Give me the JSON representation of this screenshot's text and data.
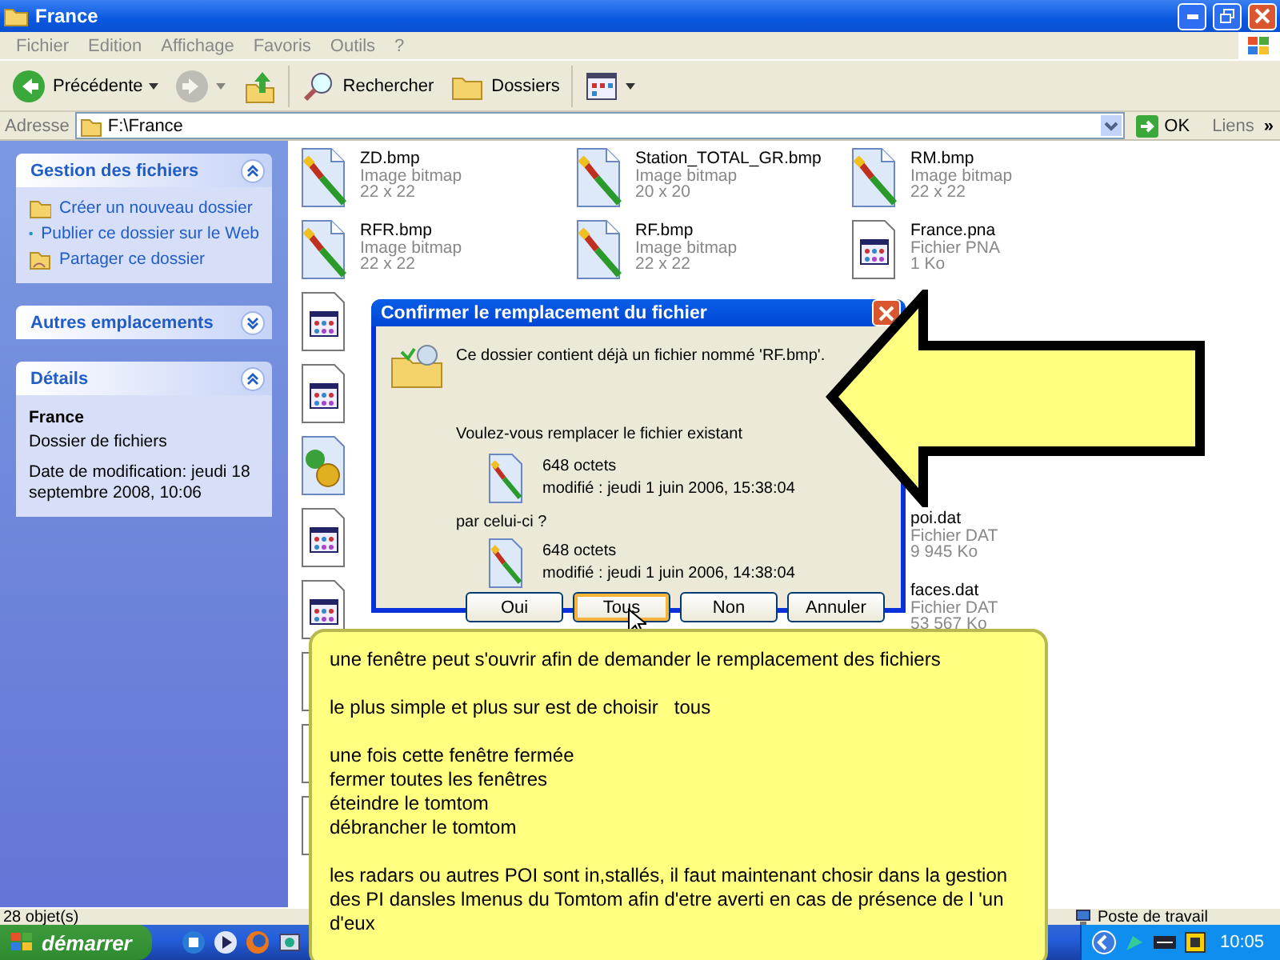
{
  "window": {
    "title": "France"
  },
  "menu": [
    {
      "label": "Fichier"
    },
    {
      "label": "Edition"
    },
    {
      "label": "Affichage"
    },
    {
      "label": "Favoris"
    },
    {
      "label": "Outils"
    },
    {
      "label": "?"
    }
  ],
  "toolbar": [
    {
      "kind": "back",
      "label": "Précédente",
      "disabled": false
    },
    {
      "kind": "forward",
      "disabled": true
    },
    {
      "kind": "up",
      "disabled": false
    },
    {
      "kind": "search",
      "label": "Rechercher",
      "disabled": false
    },
    {
      "kind": "folders",
      "label": "Dossiers",
      "disabled": false
    },
    {
      "kind": "views",
      "disabled": false
    }
  ],
  "address": {
    "label": "Adresse",
    "value": "F:\\France",
    "go": "OK",
    "links": "Liens",
    "more": "»"
  },
  "sidebar": [
    {
      "title": "Gestion des fichiers",
      "expanded": true,
      "links": [
        {
          "label": "Créer un nouveau dossier"
        },
        {
          "label": "Publier ce dossier sur le Web"
        },
        {
          "label": "Partager ce dossier"
        }
      ]
    },
    {
      "title": "Autres emplacements",
      "expanded": false
    },
    {
      "title": "Détails",
      "expanded": true,
      "details": {
        "name": "France",
        "type": "Dossier de fichiers",
        "modified": "Date de modification: jeudi 18 septembre 2008, 10:06"
      }
    }
  ],
  "file_columns": [
    [
      {
        "kind": "bitmap",
        "name": "ZD.bmp",
        "type": "Image bitmap",
        "size": "22 x 22"
      },
      {
        "kind": "bitmap",
        "name": "RFR.bmp",
        "type": "Image bitmap",
        "size": "22 x 22"
      },
      {
        "kind": "document"
      },
      {
        "kind": "document"
      },
      {
        "kind": "setup"
      },
      {
        "kind": "document"
      },
      {
        "kind": "document"
      },
      {
        "kind": "document"
      },
      {
        "kind": "document"
      },
      {
        "kind": "document"
      }
    ],
    [
      {
        "kind": "bitmap",
        "name": "Station_TOTAL_GR.bmp",
        "type": "Image bitmap",
        "size": "20 x 20"
      },
      {
        "kind": "bitmap",
        "name": "RF.bmp",
        "type": "Image bitmap",
        "size": "22 x 22"
      }
    ],
    [
      {
        "kind": "bitmap",
        "name": "RM.bmp",
        "type": "Image bitmap",
        "size": "22 x 22"
      },
      {
        "kind": "document",
        "name": "France.pna",
        "type": "Fichier PNA",
        "size": "1 Ko"
      },
      {
        "kind": "covered"
      },
      {
        "kind": "covered"
      },
      {
        "kind": "covered"
      },
      {
        "kind": "covered",
        "name": "poi.dat",
        "type": "Fichier DAT",
        "size": "9 945 Ko"
      },
      {
        "kind": "covered",
        "name": "faces.dat",
        "type": "Fichier DAT",
        "size": "53 567 Ko"
      }
    ]
  ],
  "status_bar": {
    "count": "28 objet(s)",
    "location": "Poste de travail"
  },
  "taskbar": {
    "start": "démarrer",
    "time": "10:05"
  },
  "dialog": {
    "title": "Confirmer le remplacement du fichier",
    "message": "Ce dossier contient déjà un fichier nommé 'RF.bmp'.",
    "question": "Voulez-vous remplacer le fichier existant",
    "existing": {
      "size": "648 octets",
      "modified": "modifié : jeudi 1 juin 2006, 15:38:04"
    },
    "by": "par celui-ci ?",
    "replacement": {
      "size": "648 octets",
      "modified": "modifié : jeudi 1 juin 2006, 14:38:04"
    },
    "buttons": [
      {
        "label": "Oui",
        "hovered": false
      },
      {
        "label": "Tous",
        "hovered": true
      },
      {
        "label": "Non",
        "hovered": false
      },
      {
        "label": "Annuler",
        "hovered": false
      }
    ]
  },
  "note": {
    "paragraphs": [
      [
        "une fenêtre peut s'ouvrir afin de demander le remplacement des fichiers"
      ],
      [
        "le plus simple et plus sur est de choisir   tous"
      ],
      [
        "une fois cette fenêtre fermée",
        "fermer toutes les fenêtres",
        "éteindre le tomtom",
        "débrancher le tomtom"
      ],
      [
        "les radars ou autres POI sont in,stallés, il faut maintenant chosir dans la gestion des PI dansles lmenus du Tomtom afin d'etre averti en cas de présence de l 'un d'eux"
      ]
    ]
  }
}
